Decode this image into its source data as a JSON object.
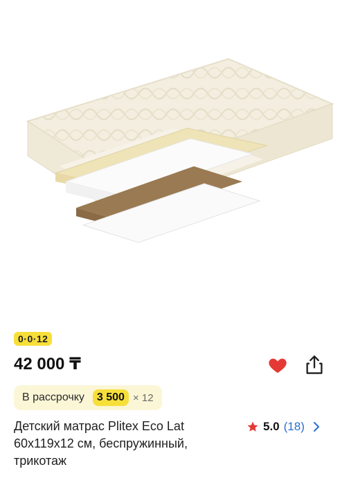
{
  "product": {
    "badge": "0·0·12",
    "price": "42 000 ₸",
    "installment": {
      "label": "В рассрочку",
      "amount": "3 500",
      "term": "× 12"
    },
    "title": "Детский матрас Plitex Eco Lat 60x119x12 см, беспружинный, трикотаж",
    "rating": {
      "score": "5.0",
      "count": "(18)"
    }
  },
  "icons": {
    "favorite": "heart-icon",
    "share": "share-icon",
    "rating": "star-icon",
    "more": "chevron-right-icon"
  },
  "colors": {
    "badge_yellow": "#f7df3a",
    "installment_bg": "#fbf6d6",
    "heart_red": "#e53935",
    "star_red": "#e53935",
    "link_blue": "#2b6fd1"
  }
}
